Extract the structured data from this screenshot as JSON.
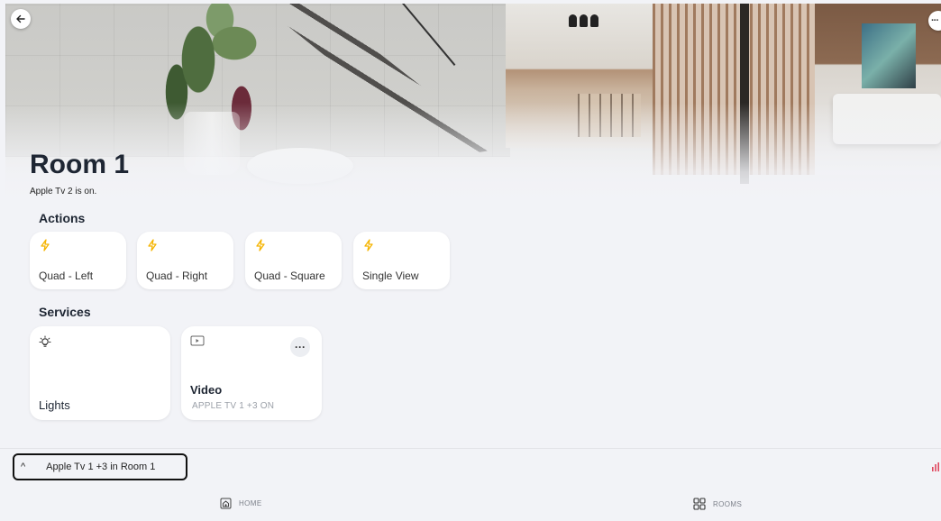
{
  "header": {
    "back_icon": "arrow-left-icon",
    "more_icon": "more-horizontal-icon",
    "more_label": "···"
  },
  "room": {
    "title": "Room 1",
    "status": "Apple Tv 2 is on."
  },
  "actions": {
    "section_title": "Actions",
    "icon": "lightning-icon",
    "accent_color": "#f5b400",
    "items": [
      {
        "label": "Quad - Left"
      },
      {
        "label": "Quad - Right"
      },
      {
        "label": "Quad - Square"
      },
      {
        "label": "Single View"
      }
    ]
  },
  "services": {
    "section_title": "Services",
    "items": [
      {
        "name": "Lights",
        "icon": "lightbulb-icon",
        "subtitle": ""
      },
      {
        "name": "Video",
        "icon": "tv-play-icon",
        "subtitle": "APPLE TV 1 +3 ON",
        "more_label": "···"
      }
    ]
  },
  "now_playing": {
    "chevron": "^",
    "text": "Apple Tv 1 +3 in Room 1",
    "eq_icon": "equalizer-icon",
    "eq_color": "#e0475e"
  },
  "bottom_nav": {
    "items": [
      {
        "label": "HOME",
        "icon": "home-icon"
      },
      {
        "label": "ROOMS",
        "icon": "grid-icon"
      }
    ]
  }
}
